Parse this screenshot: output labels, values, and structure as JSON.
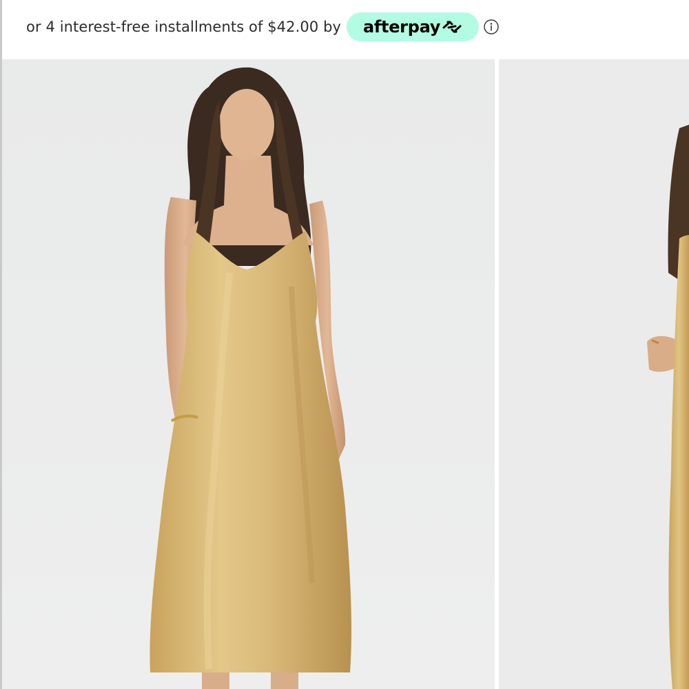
{
  "payment": {
    "installments_text": "or 4 interest-free installments of $42.00 by",
    "provider_name": "afterpay",
    "provider_icon": "afterpay-arrows-icon",
    "info_icon": "info-circle-icon"
  },
  "gallery": {
    "images": [
      {
        "subject": "model-in-gold-satin-slip-dress-front"
      },
      {
        "subject": "model-in-gold-satin-slip-dress-side"
      }
    ]
  },
  "colors": {
    "afterpay_mint": "#b2fce4",
    "photo_background": "#ebebeb",
    "dress_gold": "#d8b876",
    "text": "#2b2b2b"
  }
}
